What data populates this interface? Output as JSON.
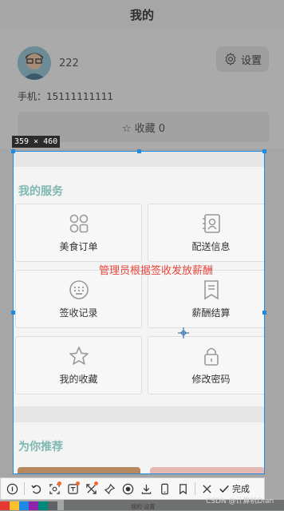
{
  "header": {
    "title": "我的"
  },
  "profile": {
    "username": "222",
    "settings_label": "设置",
    "phone_label": "手机：",
    "phone_value": "15111111111",
    "favorites_label": "☆ 收藏 0"
  },
  "capture": {
    "size_label": "359 × 460",
    "services_title": "我的服务",
    "services": [
      {
        "label": "美食订单",
        "icon": "grid-icon"
      },
      {
        "label": "配送信息",
        "icon": "contact-card-icon"
      },
      {
        "label": "签收记录",
        "icon": "keyboard-icon"
      },
      {
        "label": "薪酬结算",
        "icon": "receipt-icon"
      },
      {
        "label": "我的收藏",
        "icon": "star-icon"
      },
      {
        "label": "修改密码",
        "icon": "lock-icon"
      }
    ],
    "annotation": "管理员根据签收发放薪酬",
    "recommend_title": "为你推荐"
  },
  "toolbar": {
    "done_label": "完成"
  },
  "bottom": {
    "tab_text": "我的 设置",
    "watermark": "CSDN @计算机Dian"
  },
  "colors": {
    "accent": "#7fb8b0",
    "selection": "#1c8be0",
    "annotation": "#e8453c"
  }
}
